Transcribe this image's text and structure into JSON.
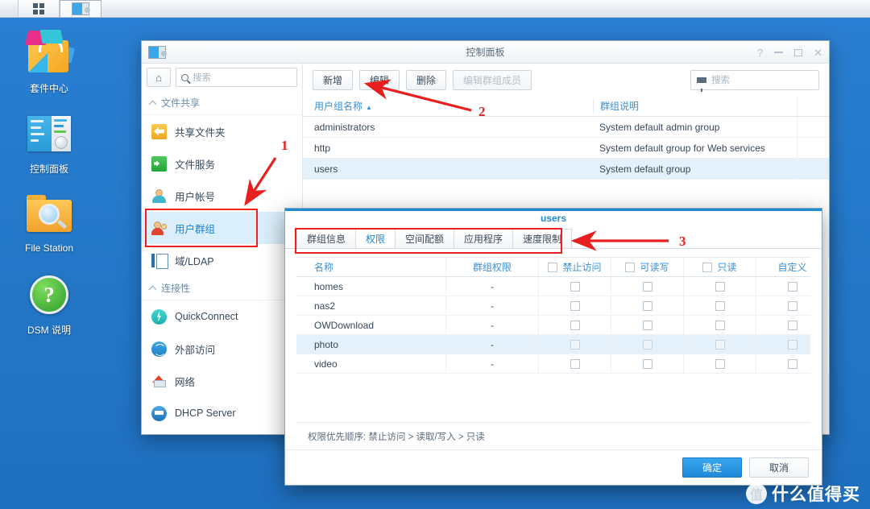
{
  "taskbar": {
    "items": [
      {
        "icon": "app-grid-icon",
        "active": false
      },
      {
        "icon": "control-panel-icon",
        "active": true
      }
    ]
  },
  "desktop": {
    "icons": [
      {
        "label": "套件中心",
        "icon": "package-center-icon"
      },
      {
        "label": "控制面板",
        "icon": "control-panel-icon"
      },
      {
        "label": "File Station",
        "icon": "file-station-icon"
      },
      {
        "label": "DSM 说明",
        "icon": "dsm-help-icon"
      }
    ]
  },
  "window": {
    "title": "控制面板",
    "icon": "control-panel-icon",
    "controls": {
      "help": "?",
      "minimize": "−",
      "maximize": "□",
      "close": "✕"
    }
  },
  "sidebar": {
    "home_icon": "home-icon",
    "search": {
      "placeholder": "搜索",
      "value": "",
      "icon": "search-icon"
    },
    "sections": [
      {
        "label": "文件共享",
        "items": [
          {
            "label": "共享文件夹",
            "icon": "shared-folder-icon",
            "selected": false
          },
          {
            "label": "文件服务",
            "icon": "file-service-icon",
            "selected": false
          },
          {
            "label": "用户帐号",
            "icon": "user-account-icon",
            "selected": false
          },
          {
            "label": "用户群组",
            "icon": "user-group-icon",
            "selected": true
          },
          {
            "label": "域/LDAP",
            "icon": "domain-ldap-icon",
            "selected": false
          }
        ]
      },
      {
        "label": "连接性",
        "items": [
          {
            "label": "QuickConnect",
            "icon": "quickconnect-icon",
            "selected": false
          },
          {
            "label": "外部访问",
            "icon": "external-access-icon",
            "selected": false
          },
          {
            "label": "网络",
            "icon": "network-icon",
            "selected": false
          },
          {
            "label": "DHCP Server",
            "icon": "dhcp-server-icon",
            "selected": false
          }
        ]
      }
    ]
  },
  "toolbar": {
    "buttons": [
      {
        "label": "新增",
        "disabled": false
      },
      {
        "label": "编辑",
        "disabled": false
      },
      {
        "label": "删除",
        "disabled": false
      },
      {
        "label": "编辑群组成员",
        "disabled": true
      }
    ],
    "search": {
      "placeholder": "搜索",
      "value": "",
      "icon": "filter-icon"
    }
  },
  "group_table": {
    "columns": [
      {
        "label": "用户组名称",
        "sort": "▲"
      },
      {
        "label": "群组说明",
        "sort": ""
      }
    ],
    "rows": [
      {
        "name": "administrators",
        "desc": "System default admin group",
        "selected": false
      },
      {
        "name": "http",
        "desc": "System default group for Web services",
        "selected": false
      },
      {
        "name": "users",
        "desc": "System default group",
        "selected": true
      }
    ]
  },
  "dialog": {
    "title": "users",
    "tabs": [
      {
        "label": "群组信息",
        "active": false
      },
      {
        "label": "权限",
        "active": true
      },
      {
        "label": "空间配额",
        "active": false
      },
      {
        "label": "应用程序",
        "active": false
      },
      {
        "label": "速度限制",
        "active": false
      }
    ],
    "permission_table": {
      "columns": [
        {
          "label": "名称",
          "has_checkbox": false
        },
        {
          "label": "群组权限",
          "has_checkbox": false
        },
        {
          "label": "禁止访问",
          "has_checkbox": true
        },
        {
          "label": "可读写",
          "has_checkbox": true
        },
        {
          "label": "只读",
          "has_checkbox": true
        },
        {
          "label": "自定义",
          "has_checkbox": false
        }
      ],
      "rows": [
        {
          "name": "homes",
          "perm": "-",
          "no_access": false,
          "read_write": false,
          "read_only": false,
          "custom": false,
          "selected": false
        },
        {
          "name": "nas2",
          "perm": "-",
          "no_access": false,
          "read_write": false,
          "read_only": false,
          "custom": false,
          "selected": false
        },
        {
          "name": "OWDownload",
          "perm": "-",
          "no_access": false,
          "read_write": false,
          "read_only": false,
          "custom": false,
          "selected": false
        },
        {
          "name": "photo",
          "perm": "-",
          "no_access": false,
          "read_write": false,
          "read_only": false,
          "custom": false,
          "selected": true
        },
        {
          "name": "video",
          "perm": "-",
          "no_access": false,
          "read_write": false,
          "read_only": false,
          "custom": false,
          "selected": false
        }
      ]
    },
    "note": "权限优先顺序: 禁止访问 > 读取/写入 > 只读",
    "buttons": {
      "ok": "确定",
      "cancel": "取消"
    }
  },
  "annotations": {
    "color": "#e81f1f",
    "markers": [
      {
        "number": "1",
        "target": "sidebar-item-user-group"
      },
      {
        "number": "2",
        "target": "toolbar-edit-button"
      },
      {
        "number": "3",
        "target": "dialog-tabs"
      }
    ]
  },
  "watermark": {
    "badge": "值",
    "text": "什么值得买"
  }
}
